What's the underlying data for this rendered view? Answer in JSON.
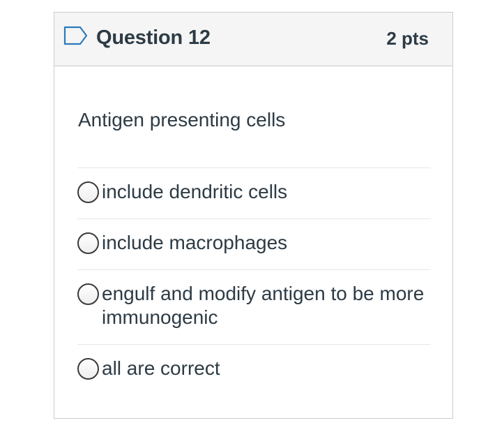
{
  "question": {
    "title": "Question 12",
    "points": "2 pts",
    "text": "Antigen presenting cells",
    "flag_icon": "flag-outline-icon"
  },
  "answers": [
    {
      "label": "include dendritic cells",
      "selected": false
    },
    {
      "label": "include macrophages",
      "selected": false
    },
    {
      "label": "engulf and modify antigen to be more immunogenic",
      "selected": false
    },
    {
      "label": "all are correct",
      "selected": false
    }
  ],
  "colors": {
    "header_bg": "#f5f5f5",
    "border": "#c7cdd1",
    "text": "#2d3b45",
    "flag": "#2b7abc"
  }
}
